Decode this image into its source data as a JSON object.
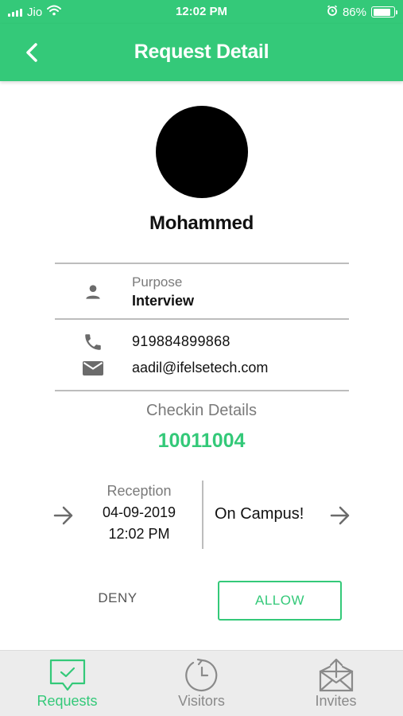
{
  "status_bar": {
    "carrier": "Jio",
    "time": "12:02 PM",
    "battery": "86%",
    "battery_level": 0.86
  },
  "header": {
    "title": "Request Detail",
    "back_icon": "chevron-left-icon"
  },
  "profile": {
    "name": "Mohammed"
  },
  "purpose": {
    "label": "Purpose",
    "value": "Interview",
    "icon": "person-icon"
  },
  "contact": {
    "phone": "919884899868",
    "phone_icon": "phone-icon",
    "email": "aadil@ifelsetech.com",
    "email_icon": "mail-icon"
  },
  "checkin": {
    "label": "Checkin Details",
    "id": "10011004",
    "location": "Reception",
    "date": "04-09-2019",
    "time": "12:02 PM",
    "status": "On Campus!"
  },
  "actions": {
    "deny": "DENY",
    "allow": "ALLOW"
  },
  "bottom_nav": {
    "items": [
      {
        "label": "Requests",
        "icon": "chat-check-icon",
        "active": true
      },
      {
        "label": "Visitors",
        "icon": "history-clock-icon",
        "active": false
      },
      {
        "label": "Invites",
        "icon": "envelope-upload-icon",
        "active": false
      }
    ]
  },
  "colors": {
    "accent": "#34c979",
    "muted": "#7a7a7a",
    "nav_bg": "#ececec"
  }
}
